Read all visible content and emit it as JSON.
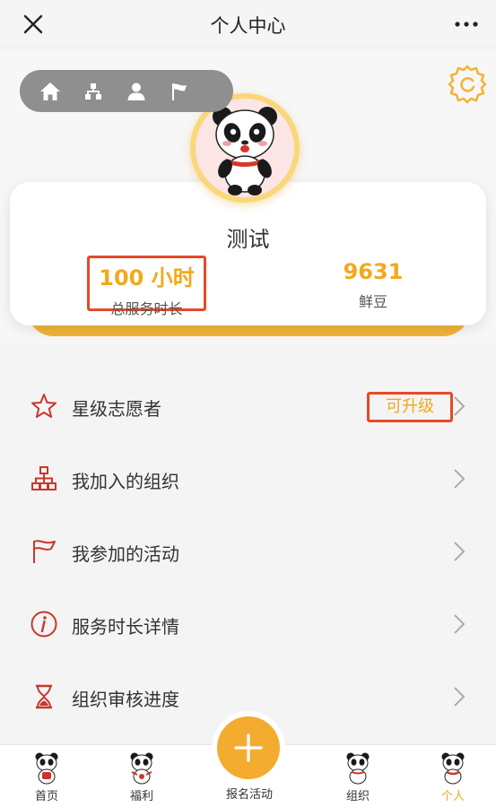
{
  "header": {
    "title": "个人中心",
    "close_icon": "close-icon",
    "more_icon": "more-dots-icon"
  },
  "quick_nav": {
    "icons": [
      "home-icon",
      "org-tree-icon",
      "user-icon",
      "flag-icon"
    ]
  },
  "profile": {
    "username": "测试",
    "stats": [
      {
        "value": "100 小时",
        "label": "总服务时长"
      },
      {
        "value": "9631",
        "label": "鲜豆"
      }
    ]
  },
  "menu": {
    "items": [
      {
        "label": "星级志愿者",
        "icon": "star-icon",
        "badge": "可升级"
      },
      {
        "label": "我加入的组织",
        "icon": "org-chart-icon"
      },
      {
        "label": "我参加的活动",
        "icon": "flag-icon"
      },
      {
        "label": "服务时长详情",
        "icon": "info-icon"
      },
      {
        "label": "组织审核进度",
        "icon": "hourglass-icon"
      }
    ]
  },
  "tabbar": {
    "tabs": [
      {
        "label": "首页"
      },
      {
        "label": "福利"
      },
      {
        "label": "报名活动"
      },
      {
        "label": "组织"
      },
      {
        "label": "个人"
      }
    ],
    "active_tab": "个人"
  },
  "colors": {
    "accent": "#f1a91c",
    "highlight_border": "#e64a26",
    "icon_red": "#c9372c",
    "fab": "#f4ac30"
  }
}
